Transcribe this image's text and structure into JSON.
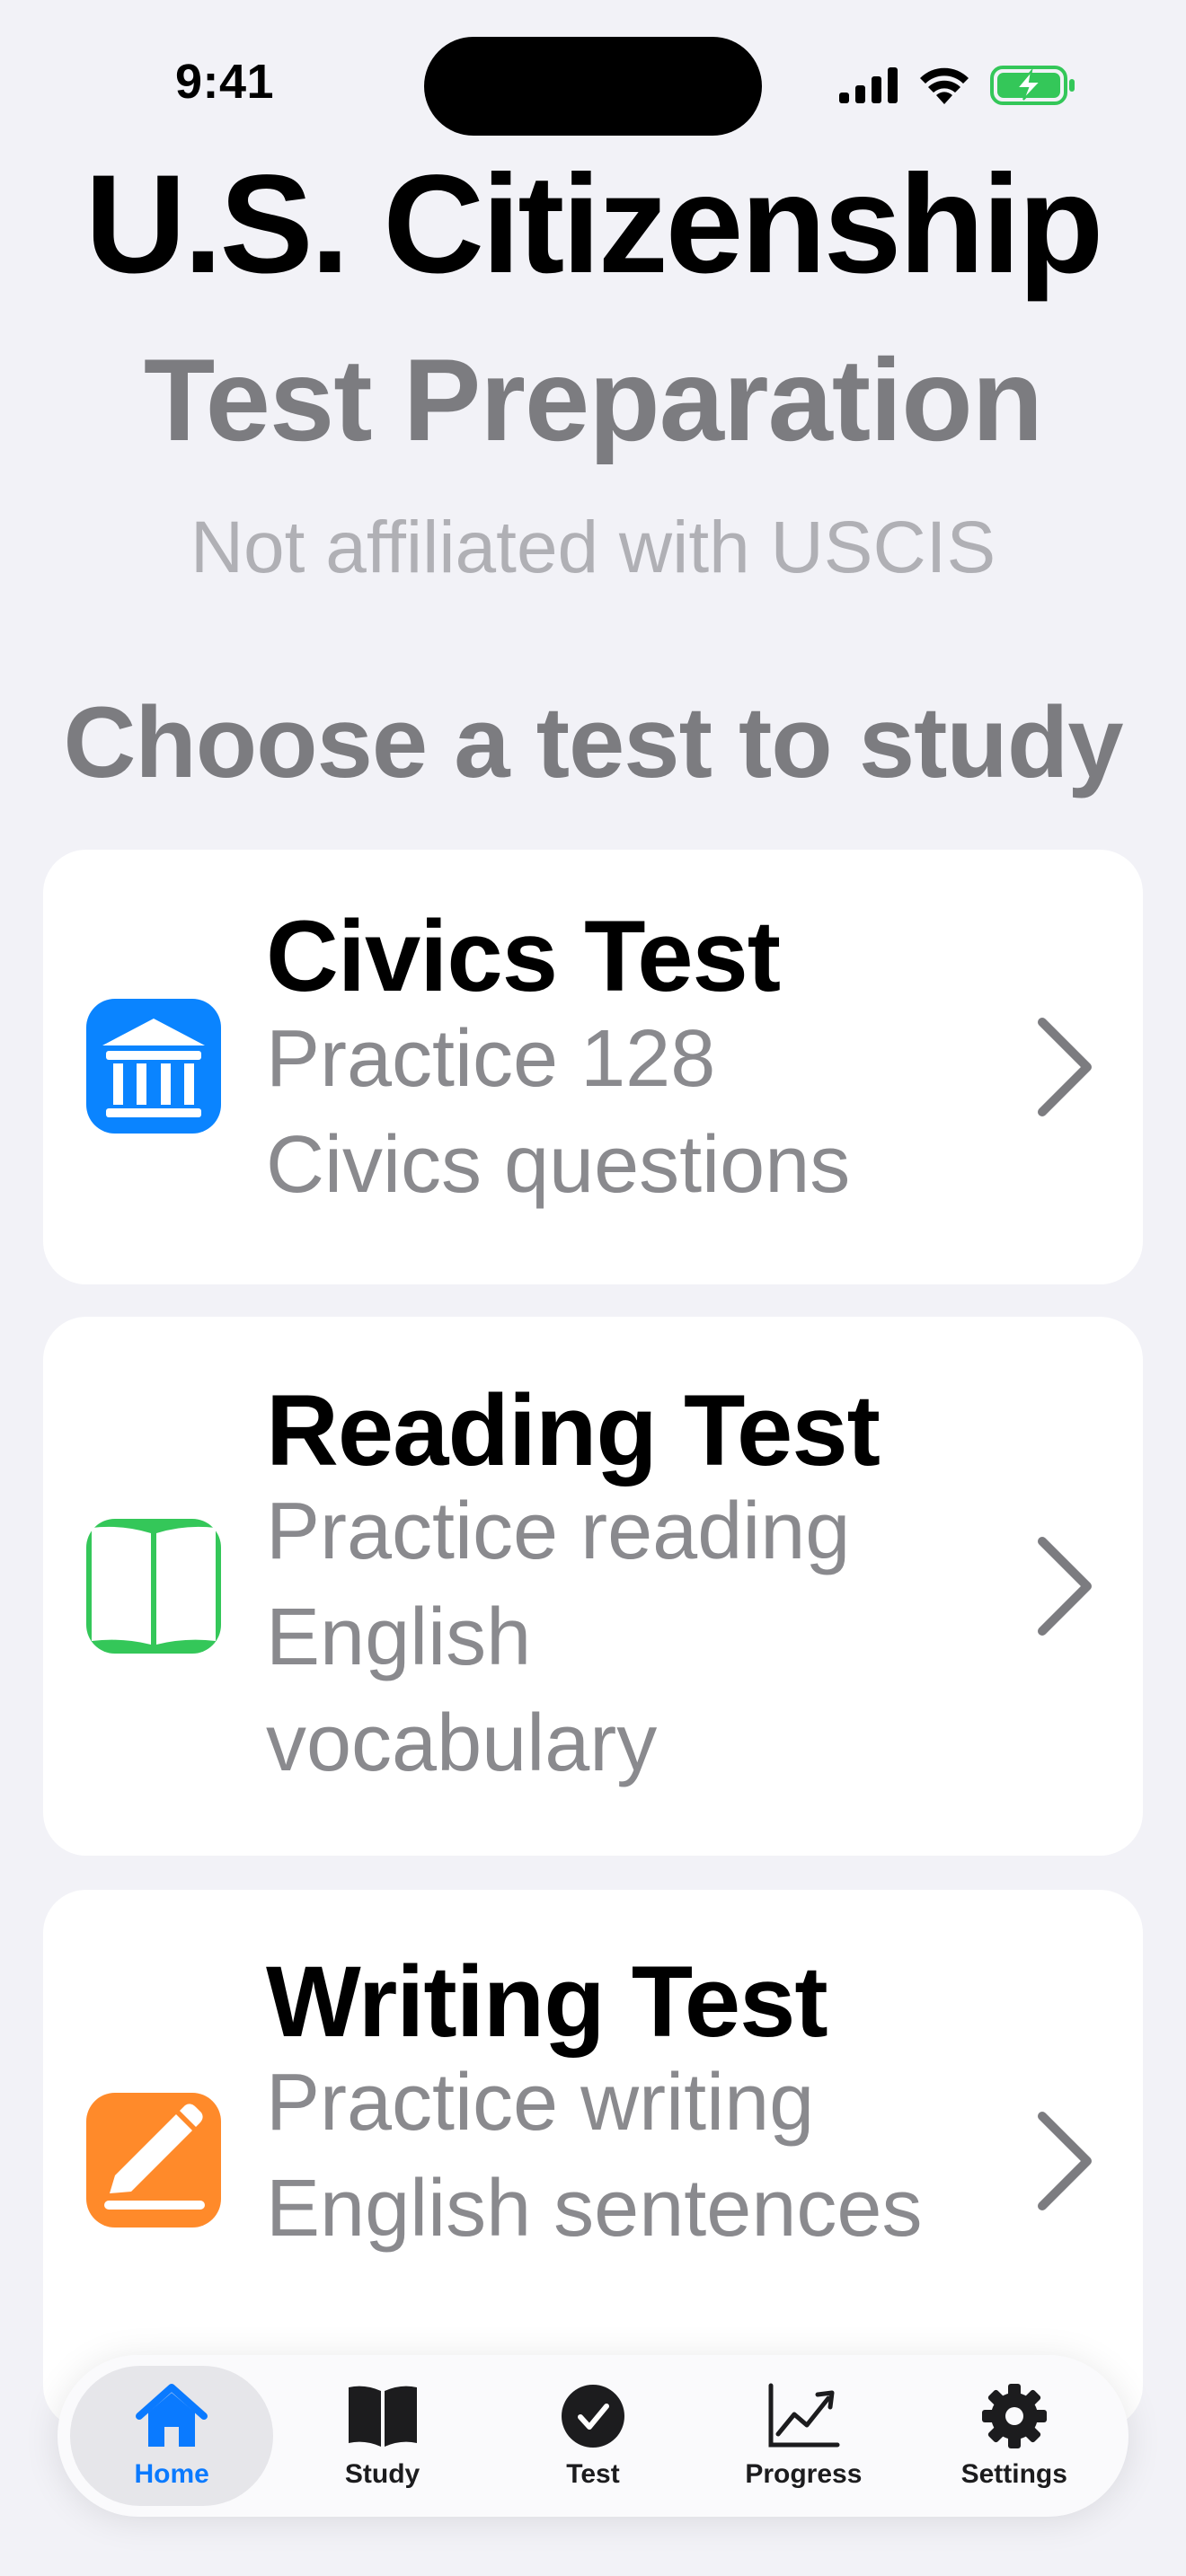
{
  "status_bar": {
    "time": "9:41"
  },
  "header": {
    "title": "U.S. Citizenship",
    "subtitle": "Test Preparation",
    "disclaimer": "Not affiliated with USCIS"
  },
  "section_heading": "Choose a test to study",
  "cards": [
    {
      "title": "Civics Test",
      "description": "Practice 128 Civics questions",
      "icon": "government-building-icon",
      "icon_color": "#0a84ff"
    },
    {
      "title": "Reading Test",
      "description": "Practice reading English vocabulary",
      "icon": "open-book-icon",
      "icon_color": "#34c759"
    },
    {
      "title": "Writing Test",
      "description": "Practice writing English sentences",
      "icon": "pencil-icon",
      "icon_color": "#ff8a2a"
    }
  ],
  "tab_bar": {
    "active_tab": "Home",
    "accent_color": "#0a7aff",
    "tabs": [
      {
        "label": "Home",
        "icon": "house-icon"
      },
      {
        "label": "Study",
        "icon": "book-icon"
      },
      {
        "label": "Test",
        "icon": "checkmark-circle-icon"
      },
      {
        "label": "Progress",
        "icon": "chart-line-icon"
      },
      {
        "label": "Settings",
        "icon": "gear-icon"
      }
    ]
  }
}
